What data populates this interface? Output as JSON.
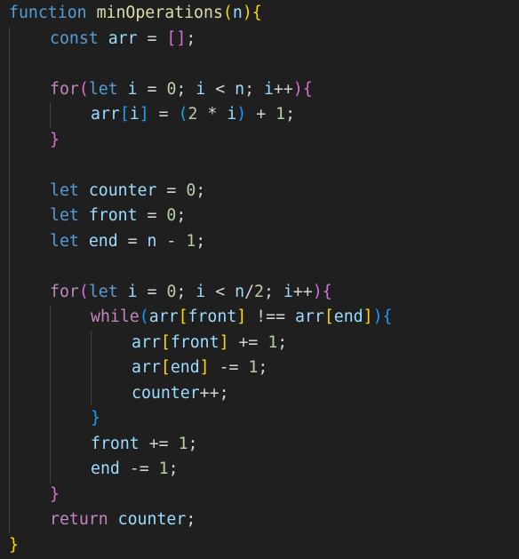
{
  "editor": {
    "language": "javascript",
    "theme_colors": {
      "background": "#1f1f1f",
      "keyword": "#569cd6",
      "control": "#c586c0",
      "function_name": "#dcdcaa",
      "variable": "#9cdcfe",
      "number": "#b5cea8",
      "operator": "#d4d4d4",
      "bracket_level_1": "#ffd700",
      "bracket_level_2": "#da70d6",
      "bracket_level_3": "#179fff"
    },
    "lines": [
      {
        "indent": 0,
        "tokens": [
          {
            "t": "function",
            "c": "kw"
          },
          {
            "t": " ",
            "c": "op"
          },
          {
            "t": "minOperations",
            "c": "fn"
          },
          {
            "t": "(",
            "c": "b1"
          },
          {
            "t": "n",
            "c": "var"
          },
          {
            "t": ")",
            "c": "b1"
          },
          {
            "t": "{",
            "c": "b1"
          }
        ]
      },
      {
        "indent": 1,
        "tokens": [
          {
            "t": "const",
            "c": "kw"
          },
          {
            "t": " ",
            "c": "op"
          },
          {
            "t": "arr",
            "c": "var"
          },
          {
            "t": " = ",
            "c": "op"
          },
          {
            "t": "[",
            "c": "b2"
          },
          {
            "t": "]",
            "c": "b2"
          },
          {
            "t": ";",
            "c": "op"
          }
        ]
      },
      {
        "indent": 0,
        "tokens": []
      },
      {
        "indent": 1,
        "tokens": [
          {
            "t": "for",
            "c": "ctl"
          },
          {
            "t": "(",
            "c": "b2"
          },
          {
            "t": "let",
            "c": "kw"
          },
          {
            "t": " ",
            "c": "op"
          },
          {
            "t": "i",
            "c": "var"
          },
          {
            "t": " = ",
            "c": "op"
          },
          {
            "t": "0",
            "c": "num"
          },
          {
            "t": "; ",
            "c": "op"
          },
          {
            "t": "i",
            "c": "var"
          },
          {
            "t": " < ",
            "c": "op"
          },
          {
            "t": "n",
            "c": "var"
          },
          {
            "t": "; ",
            "c": "op"
          },
          {
            "t": "i",
            "c": "var"
          },
          {
            "t": "++",
            "c": "op"
          },
          {
            "t": ")",
            "c": "b2"
          },
          {
            "t": "{",
            "c": "b2"
          }
        ]
      },
      {
        "indent": 2,
        "tokens": [
          {
            "t": "arr",
            "c": "var"
          },
          {
            "t": "[",
            "c": "b3"
          },
          {
            "t": "i",
            "c": "var"
          },
          {
            "t": "]",
            "c": "b3"
          },
          {
            "t": " = ",
            "c": "op"
          },
          {
            "t": "(",
            "c": "b3"
          },
          {
            "t": "2",
            "c": "num"
          },
          {
            "t": " * ",
            "c": "op"
          },
          {
            "t": "i",
            "c": "var"
          },
          {
            "t": ")",
            "c": "b3"
          },
          {
            "t": " + ",
            "c": "op"
          },
          {
            "t": "1",
            "c": "num"
          },
          {
            "t": ";",
            "c": "op"
          }
        ]
      },
      {
        "indent": 1,
        "tokens": [
          {
            "t": "}",
            "c": "b2"
          }
        ]
      },
      {
        "indent": 0,
        "tokens": []
      },
      {
        "indent": 1,
        "tokens": [
          {
            "t": "let",
            "c": "kw"
          },
          {
            "t": " ",
            "c": "op"
          },
          {
            "t": "counter",
            "c": "var"
          },
          {
            "t": " = ",
            "c": "op"
          },
          {
            "t": "0",
            "c": "num"
          },
          {
            "t": ";",
            "c": "op"
          }
        ]
      },
      {
        "indent": 1,
        "tokens": [
          {
            "t": "let",
            "c": "kw"
          },
          {
            "t": " ",
            "c": "op"
          },
          {
            "t": "front",
            "c": "var"
          },
          {
            "t": " = ",
            "c": "op"
          },
          {
            "t": "0",
            "c": "num"
          },
          {
            "t": ";",
            "c": "op"
          }
        ]
      },
      {
        "indent": 1,
        "tokens": [
          {
            "t": "let",
            "c": "kw"
          },
          {
            "t": " ",
            "c": "op"
          },
          {
            "t": "end",
            "c": "var"
          },
          {
            "t": " = ",
            "c": "op"
          },
          {
            "t": "n",
            "c": "var"
          },
          {
            "t": " - ",
            "c": "op"
          },
          {
            "t": "1",
            "c": "num"
          },
          {
            "t": ";",
            "c": "op"
          }
        ]
      },
      {
        "indent": 0,
        "tokens": []
      },
      {
        "indent": 1,
        "tokens": [
          {
            "t": "for",
            "c": "ctl"
          },
          {
            "t": "(",
            "c": "b2"
          },
          {
            "t": "let",
            "c": "kw"
          },
          {
            "t": " ",
            "c": "op"
          },
          {
            "t": "i",
            "c": "var"
          },
          {
            "t": " = ",
            "c": "op"
          },
          {
            "t": "0",
            "c": "num"
          },
          {
            "t": "; ",
            "c": "op"
          },
          {
            "t": "i",
            "c": "var"
          },
          {
            "t": " < ",
            "c": "op"
          },
          {
            "t": "n",
            "c": "var"
          },
          {
            "t": "/",
            "c": "op"
          },
          {
            "t": "2",
            "c": "num"
          },
          {
            "t": "; ",
            "c": "op"
          },
          {
            "t": "i",
            "c": "var"
          },
          {
            "t": "++",
            "c": "op"
          },
          {
            "t": ")",
            "c": "b2"
          },
          {
            "t": "{",
            "c": "b2"
          }
        ]
      },
      {
        "indent": 2,
        "tokens": [
          {
            "t": "while",
            "c": "ctl"
          },
          {
            "t": "(",
            "c": "b3"
          },
          {
            "t": "arr",
            "c": "var"
          },
          {
            "t": "[",
            "c": "b1"
          },
          {
            "t": "front",
            "c": "var"
          },
          {
            "t": "]",
            "c": "b1"
          },
          {
            "t": " !== ",
            "c": "op"
          },
          {
            "t": "arr",
            "c": "var"
          },
          {
            "t": "[",
            "c": "b1"
          },
          {
            "t": "end",
            "c": "var"
          },
          {
            "t": "]",
            "c": "b1"
          },
          {
            "t": ")",
            "c": "b3"
          },
          {
            "t": "{",
            "c": "b3"
          }
        ]
      },
      {
        "indent": 3,
        "tokens": [
          {
            "t": "arr",
            "c": "var"
          },
          {
            "t": "[",
            "c": "b1"
          },
          {
            "t": "front",
            "c": "var"
          },
          {
            "t": "]",
            "c": "b1"
          },
          {
            "t": " += ",
            "c": "op"
          },
          {
            "t": "1",
            "c": "num"
          },
          {
            "t": ";",
            "c": "op"
          }
        ]
      },
      {
        "indent": 3,
        "tokens": [
          {
            "t": "arr",
            "c": "var"
          },
          {
            "t": "[",
            "c": "b1"
          },
          {
            "t": "end",
            "c": "var"
          },
          {
            "t": "]",
            "c": "b1"
          },
          {
            "t": " -= ",
            "c": "op"
          },
          {
            "t": "1",
            "c": "num"
          },
          {
            "t": ";",
            "c": "op"
          }
        ]
      },
      {
        "indent": 3,
        "tokens": [
          {
            "t": "counter",
            "c": "var"
          },
          {
            "t": "++",
            "c": "op"
          },
          {
            "t": ";",
            "c": "op"
          }
        ]
      },
      {
        "indent": 2,
        "tokens": [
          {
            "t": "}",
            "c": "b3"
          }
        ]
      },
      {
        "indent": 2,
        "tokens": [
          {
            "t": "front",
            "c": "var"
          },
          {
            "t": " += ",
            "c": "op"
          },
          {
            "t": "1",
            "c": "num"
          },
          {
            "t": ";",
            "c": "op"
          }
        ]
      },
      {
        "indent": 2,
        "tokens": [
          {
            "t": "end",
            "c": "var"
          },
          {
            "t": " -= ",
            "c": "op"
          },
          {
            "t": "1",
            "c": "num"
          },
          {
            "t": ";",
            "c": "op"
          }
        ]
      },
      {
        "indent": 1,
        "tokens": [
          {
            "t": "}",
            "c": "b2"
          }
        ]
      },
      {
        "indent": 1,
        "tokens": [
          {
            "t": "return",
            "c": "ctl"
          },
          {
            "t": " ",
            "c": "op"
          },
          {
            "t": "counter",
            "c": "var"
          },
          {
            "t": ";",
            "c": "op"
          }
        ]
      },
      {
        "indent": 0,
        "tokens": [
          {
            "t": "}",
            "c": "b1"
          }
        ]
      }
    ]
  }
}
